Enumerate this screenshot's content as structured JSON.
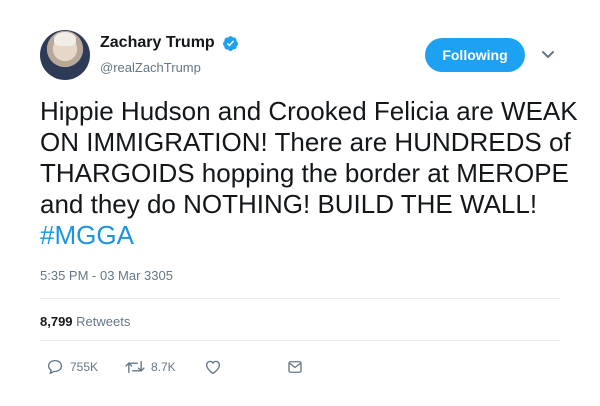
{
  "user": {
    "name": "Zachary Trump",
    "handle": "@realZachTrump",
    "verified": true
  },
  "follow_button": {
    "label": "Following"
  },
  "tweet": {
    "text": "Hippie Hudson and Crooked Felicia are WEAK ON IMMIGRATION! There are HUNDREDS of THARGOIDS hopping the border at MEROPE and they do NOTHING! BUILD THE WALL! ",
    "hashtag": "#MGGA",
    "timestamp": "5:35 PM - 03 Mar 3305"
  },
  "stats": {
    "retweets_count": "8,799",
    "retweets_label": "Retweets"
  },
  "actions": {
    "replies": "755K",
    "retweets": "8.7K",
    "icons": [
      "reply-icon",
      "retweet-icon",
      "heart-icon",
      "message-icon"
    ]
  },
  "colors": {
    "accent": "#1da1f2",
    "hashtag": "#1b95e0",
    "muted": "#657786",
    "text": "#14171a"
  }
}
